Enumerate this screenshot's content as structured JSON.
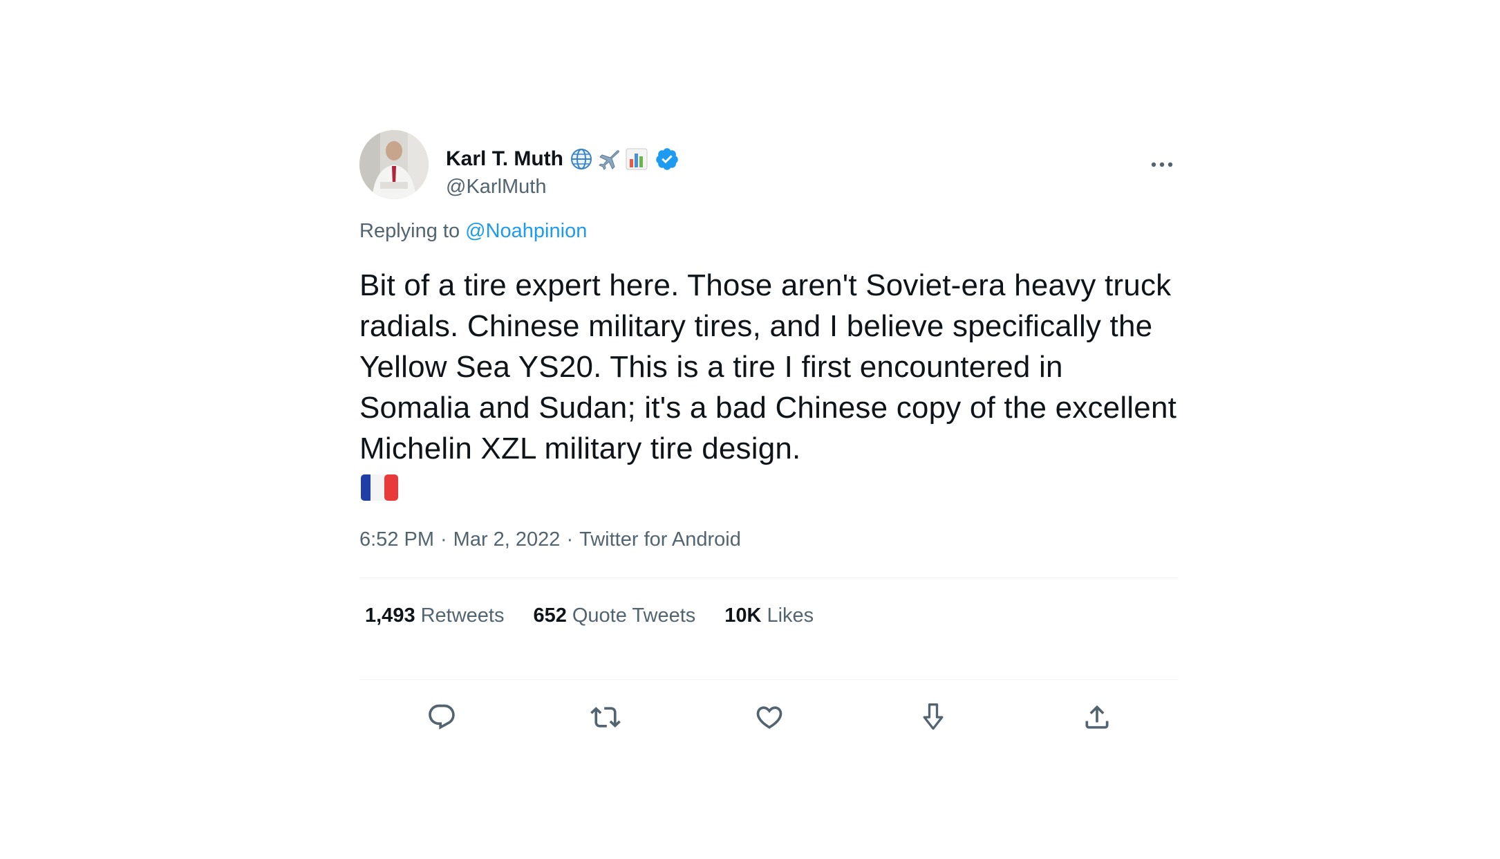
{
  "tweet": {
    "author": {
      "display_name": "Karl T. Muth",
      "handle": "@KarlMuth",
      "name_emojis": [
        "globe-icon",
        "airplane-icon",
        "bar-chart-icon"
      ],
      "verified": true
    },
    "replying_prefix": "Replying to",
    "replying_to": "@Noahpinion",
    "text": "Bit of a tire expert here. Those aren't Soviet-era heavy truck radials. Chinese military tires, and I believe specifically the Yellow Sea YS20. This is a tire I first encountered in Somalia and Sudan; it's a bad Chinese copy of the excellent Michelin XZL military tire design.",
    "trailing_emoji": "france-flag-icon",
    "time": "6:52 PM",
    "date": "Mar 2, 2022",
    "source": "Twitter for Android",
    "separator": "·"
  },
  "stats": {
    "retweets_count": "1,493",
    "retweets_label": "Retweets",
    "quotes_count": "652",
    "quotes_label": "Quote Tweets",
    "likes_count": "10K",
    "likes_label": "Likes"
  },
  "colors": {
    "text": "#0f1419",
    "secondary": "#536471",
    "link": "#1d9bf0",
    "verified": "#1d9bf0",
    "divider": "#eff3f4"
  }
}
